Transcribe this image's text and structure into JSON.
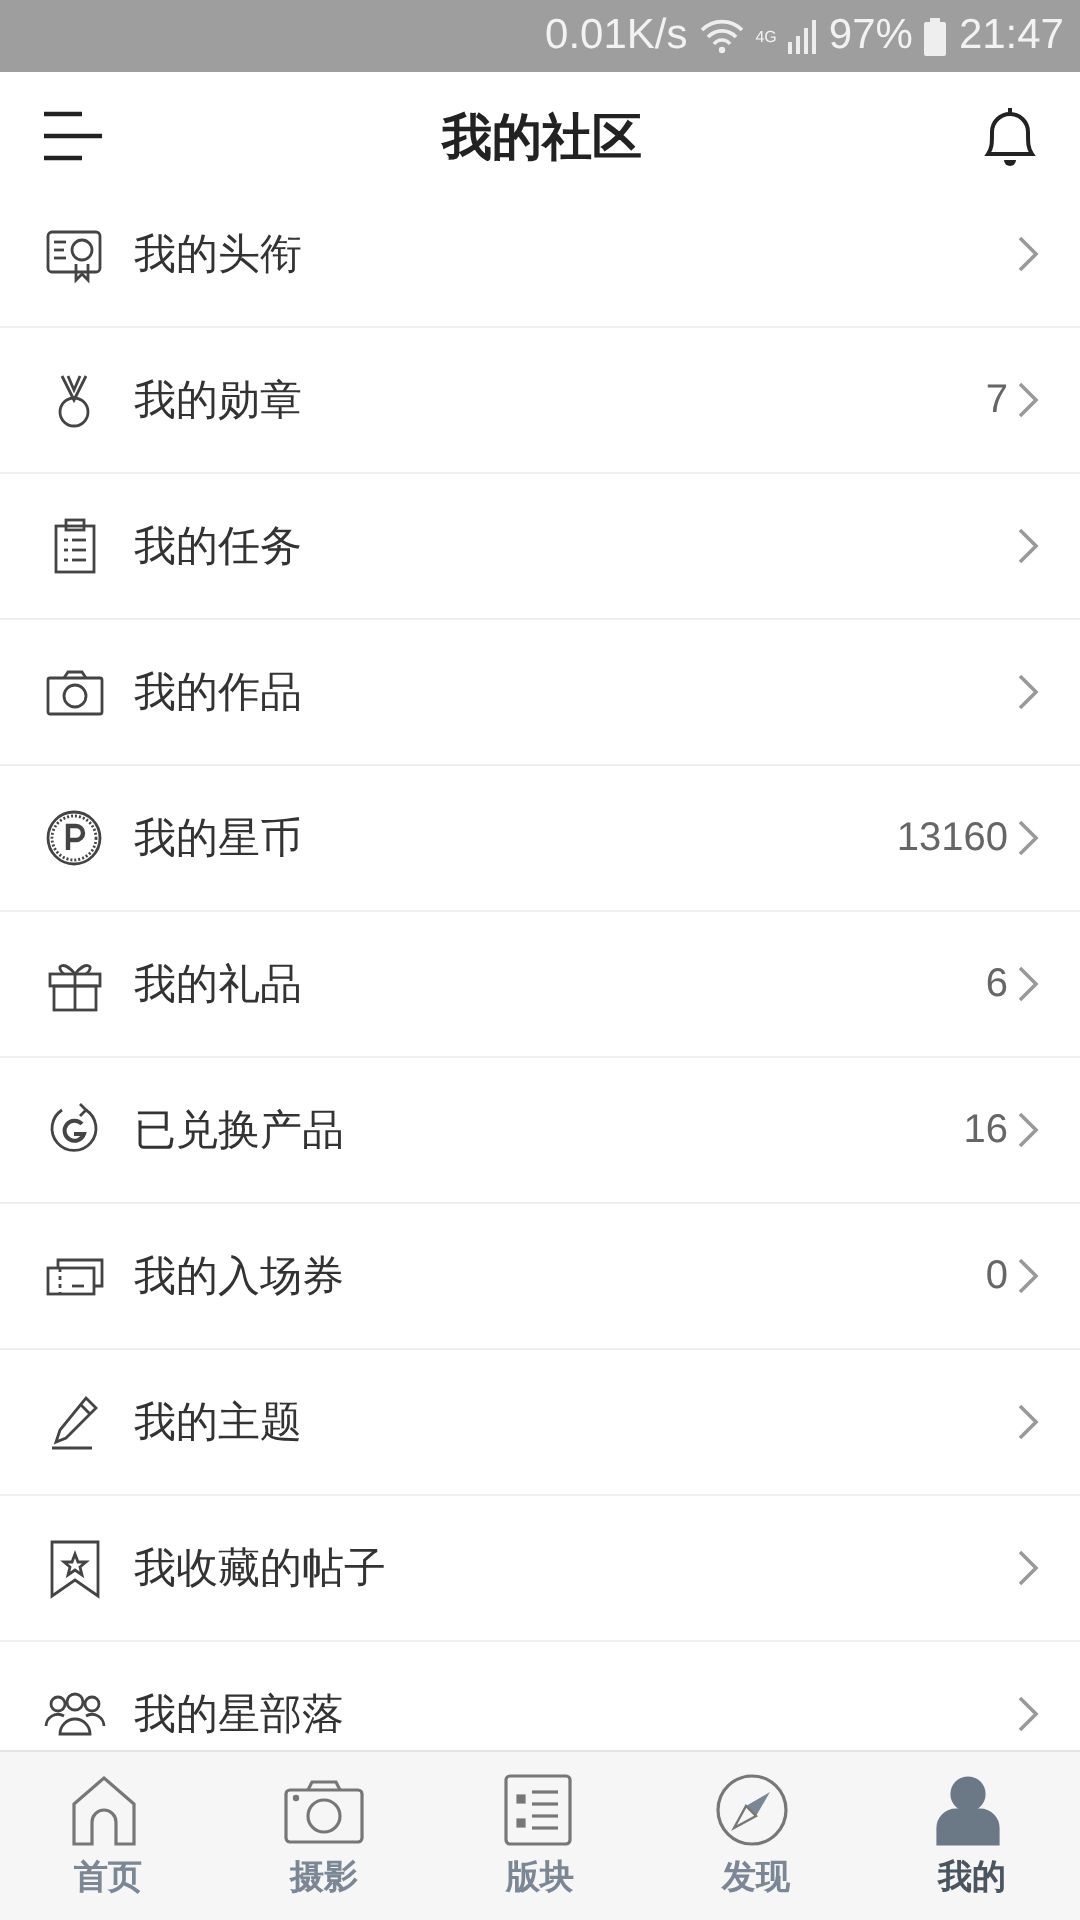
{
  "status_bar": {
    "speed": "0.01K/s",
    "network": "4G",
    "battery": "97%",
    "time": "21:47"
  },
  "header": {
    "title": "我的社区"
  },
  "items": [
    {
      "kind": "certificate",
      "label": "我的头衔"
    },
    {
      "kind": "medal",
      "label": "我的勋章",
      "count": "7"
    },
    {
      "kind": "clipboard",
      "label": "我的任务"
    },
    {
      "kind": "camera",
      "label": "我的作品"
    },
    {
      "kind": "coin",
      "label": "我的星币",
      "count": "13160"
    },
    {
      "kind": "gift",
      "label": "我的礼品",
      "count": "6"
    },
    {
      "kind": "exchange",
      "label": "已兑换产品",
      "count": "16"
    },
    {
      "kind": "ticket",
      "label": "我的入场券",
      "count": "0"
    },
    {
      "kind": "pencil",
      "label": "我的主题"
    },
    {
      "kind": "bookmark",
      "label": "我收藏的帖子"
    },
    {
      "kind": "group",
      "label": "我的星部落"
    }
  ],
  "tabs": [
    {
      "kind": "home",
      "label": "首页",
      "selected": false
    },
    {
      "kind": "camera",
      "label": "摄影",
      "selected": false
    },
    {
      "kind": "board",
      "label": "版块",
      "selected": false
    },
    {
      "kind": "compass",
      "label": "发现",
      "selected": false
    },
    {
      "kind": "person",
      "label": "我的",
      "selected": true
    }
  ]
}
